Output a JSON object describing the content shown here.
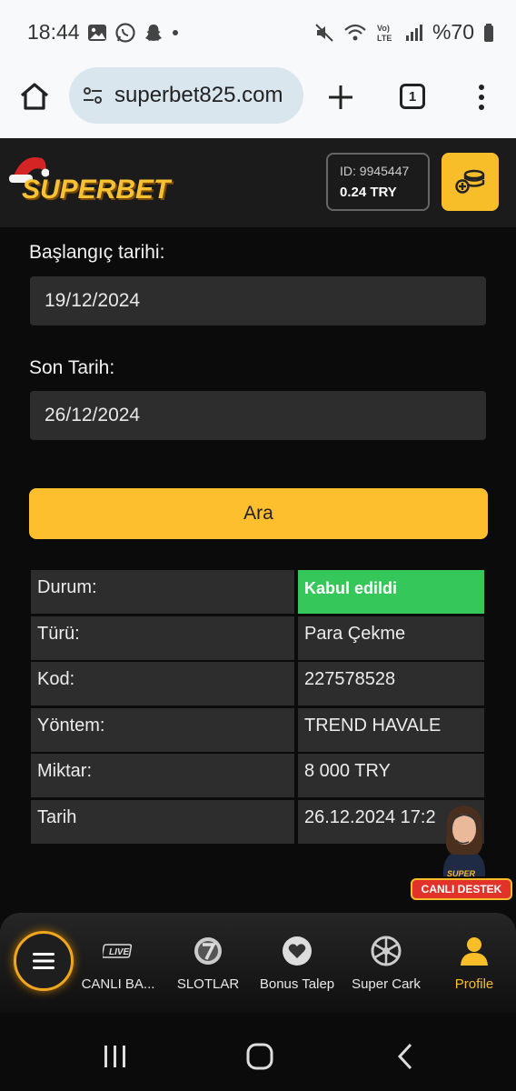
{
  "status_bar": {
    "time": "18:44",
    "battery": "%70",
    "icons": [
      "gallery-icon",
      "whatsapp-icon",
      "snapchat-icon",
      "dot-icon",
      "mute-icon",
      "wifi-icon",
      "volte-icon",
      "signal-icon",
      "battery-icon"
    ]
  },
  "browser": {
    "url": "superbet825.com",
    "tab_count": "1"
  },
  "header": {
    "logo_text": "SUPERBET",
    "id_text": "ID: 9945447",
    "balance": "0.24 TRY"
  },
  "filter": {
    "start_label": "Başlangıç tarihi:",
    "start_value": "19/12/2024",
    "end_label": "Son Tarih:",
    "end_value": "26/12/2024",
    "search_label": "Ara"
  },
  "result": {
    "rows": [
      {
        "label": "Durum:",
        "value": "Kabul edildi"
      },
      {
        "label": "Türü:",
        "value": "Para Çekme"
      },
      {
        "label": "Kod:",
        "value": "227578528"
      },
      {
        "label": "Yöntem:",
        "value": "TREND HAVALE"
      },
      {
        "label": "Miktar:",
        "value": "8 000 TRY"
      },
      {
        "label": "Tarih",
        "value": "26.12.2024 17:2"
      }
    ]
  },
  "support": {
    "small": "SUPER",
    "label": "CANLI DESTEK"
  },
  "bottom_nav": {
    "items": [
      {
        "label": "CANLI BA...",
        "icon": "live-icon"
      },
      {
        "label": "SLOTLAR",
        "icon": "slot-seven-icon"
      },
      {
        "label": "Bonus Talep",
        "icon": "heart-icon"
      },
      {
        "label": "Super Cark",
        "icon": "wheel-icon"
      },
      {
        "label": "Profile",
        "icon": "profile-icon"
      }
    ],
    "live_badge": "LIVE"
  },
  "colors": {
    "accent": "#f8be2a",
    "success": "#35c75a",
    "background": "#0b0b0b",
    "cell": "#2d2d2d"
  }
}
